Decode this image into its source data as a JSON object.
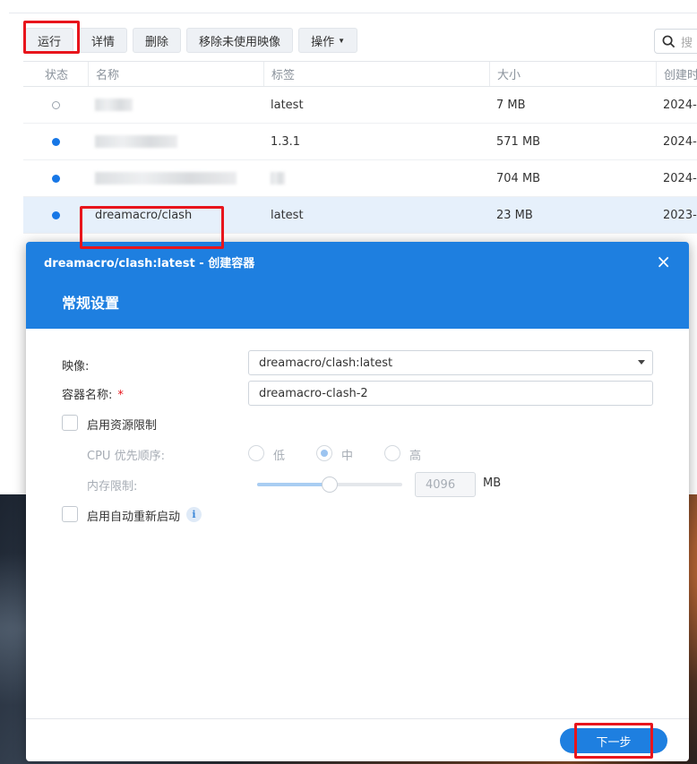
{
  "toolbar": {
    "run_label": "运行",
    "details_label": "详情",
    "delete_label": "删除",
    "remove_unused_label": "移除未使用映像",
    "actions_label": "操作"
  },
  "search": {
    "placeholder": "搜"
  },
  "table": {
    "columns": [
      "状态",
      "名称",
      "标签",
      "大小",
      "创建时"
    ],
    "rows": [
      {
        "status": "stopped",
        "name": "",
        "tag": "latest",
        "size": "7 MB",
        "created": "2024-"
      },
      {
        "status": "running",
        "name": "",
        "tag": "1.3.1",
        "size": "571 MB",
        "created": "2024-"
      },
      {
        "status": "running",
        "name": "",
        "tag": "",
        "size": "704 MB",
        "created": "2024-"
      },
      {
        "status": "running",
        "name": "dreamacro/clash",
        "tag": "latest",
        "size": "23 MB",
        "created": "2023-"
      }
    ]
  },
  "dialog": {
    "caption": "dreamacro/clash:latest - 创建容器",
    "section_title": "常规设置",
    "image_label": "映像:",
    "image_value": "dreamacro/clash:latest",
    "container_name_label": "容器名称:",
    "required_mark": "*",
    "container_name_value": "dreamacro-clash-2",
    "enable_resource_limit_label": "启用资源限制",
    "cpu_priority_label": "CPU 优先顺序:",
    "cpu_options": [
      "低",
      "中",
      "高"
    ],
    "cpu_selected": "中",
    "memory_limit_label": "内存限制:",
    "memory_value": "4096",
    "memory_unit": "MB",
    "memory_slider_fraction": 0.5,
    "auto_restart_label": "启用自动重新启动",
    "info_glyph": "i",
    "next_label": "下一步",
    "close_glyph": "×"
  },
  "colors": {
    "accent": "#1e7fe0",
    "highlight_box": "#e8151c",
    "selected_row": "#e6f0fb"
  }
}
